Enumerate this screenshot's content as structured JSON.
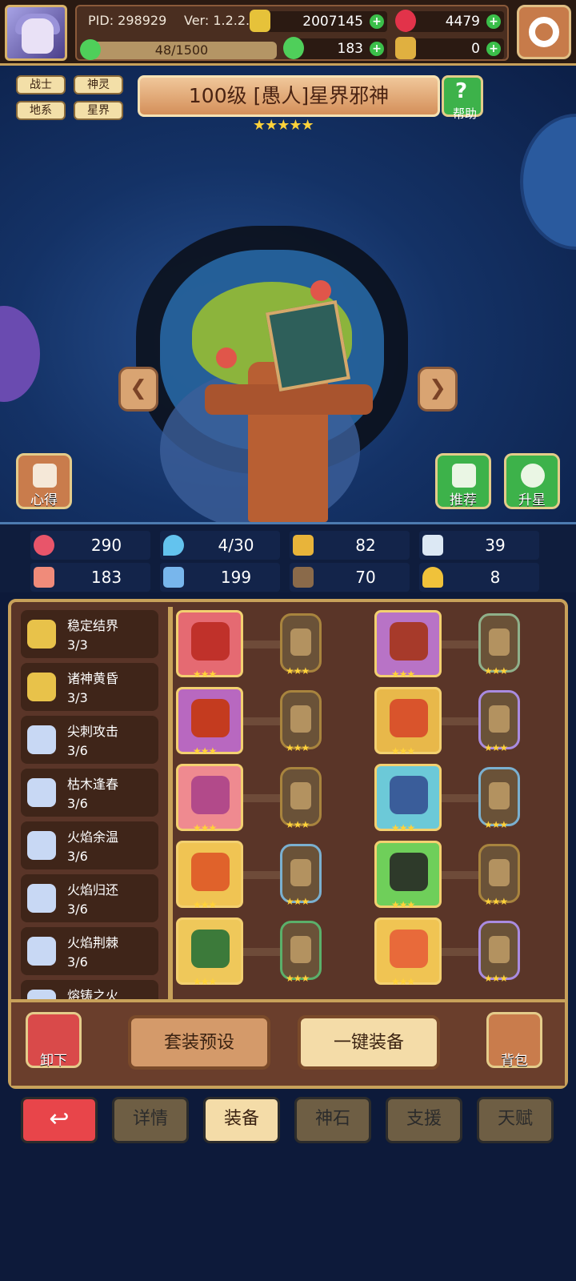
{
  "player": {
    "pid": "PID: 298929",
    "version": "Ver: 1.2.2.1",
    "gold": "2007145",
    "gems": "4479",
    "exp": "48/1500",
    "clover": "183",
    "keys": "0"
  },
  "hero": {
    "tags": [
      "战士",
      "神灵",
      "地系",
      "星界"
    ],
    "title": "100级 [愚人]星界邪神",
    "stars": "★★★★★",
    "help_label": "帮助",
    "prev_arrow": "❮",
    "next_arrow": "❯",
    "left_button": "心得",
    "recommend_button": "推荐",
    "upgrade_button": "升星"
  },
  "stats": [
    {
      "icon": "heart-icon",
      "value": "290",
      "color": "#e8556a"
    },
    {
      "icon": "water-drop-icon",
      "value": "4/30",
      "color": "#63c3ee"
    },
    {
      "icon": "shield-icon",
      "value": "82",
      "color": "#e8b43a"
    },
    {
      "icon": "wing-icon",
      "value": "39",
      "color": "#dce8f4"
    },
    {
      "icon": "fist-icon",
      "value": "183",
      "color": "#f08b7a"
    },
    {
      "icon": "book-icon",
      "value": "199",
      "color": "#78b6ec"
    },
    {
      "icon": "boot-icon",
      "value": "70",
      "color": "#8a6a4a"
    },
    {
      "icon": "horseshoe-icon",
      "value": "8",
      "color": "#f0c23a"
    }
  ],
  "sets": [
    {
      "name": "稳定结界",
      "count": "3/3",
      "color": "#e8c24a"
    },
    {
      "name": "诸神黄昏",
      "count": "3/3",
      "color": "#e8c24a"
    },
    {
      "name": "尖刺攻击",
      "count": "3/6",
      "color": "#c8d8f4"
    },
    {
      "name": "枯木逢春",
      "count": "3/6",
      "color": "#c8d8f4"
    },
    {
      "name": "火焰余温",
      "count": "3/6",
      "color": "#c8d8f4"
    },
    {
      "name": "火焰归还",
      "count": "3/6",
      "color": "#c8d8f4"
    },
    {
      "name": "火焰荆棘",
      "count": "3/6",
      "color": "#c8d8f4"
    },
    {
      "name": "熔铸之火",
      "count": "",
      "color": "#c8d8f4"
    }
  ],
  "equipment": [
    {
      "bg": "#e56a72",
      "art": "#c0312a",
      "stars": "★★★",
      "slot_border": "#a8843e"
    },
    {
      "bg": "#b873c6",
      "art": "#a73a2a",
      "stars": "★★★",
      "slot_border": "#8fb08a"
    },
    {
      "bg": "#b868c0",
      "art": "#c43b1f",
      "stars": "★★★",
      "slot_border": "#a8843e"
    },
    {
      "bg": "#e8b84a",
      "art": "#d9542c",
      "stars": "★★★",
      "slot_border": "#a98be0"
    },
    {
      "bg": "#ef8a90",
      "art": "#b24a8a",
      "stars": "★★★",
      "slot_border": "#a8843e"
    },
    {
      "bg": "#6cc9d8",
      "art": "#3a5d9a",
      "stars": "★★★",
      "slot_border": "#7ab0d0"
    },
    {
      "bg": "#f0c453",
      "art": "#e0622b",
      "stars": "★★★",
      "slot_border": "#7ab0d0"
    },
    {
      "bg": "#6fcf5a",
      "art": "#2e3a2a",
      "stars": "★★★",
      "slot_border": "#a8843e"
    },
    {
      "bg": "#efc85a",
      "art": "#3c7a3a",
      "stars": "★★★",
      "slot_border": "#5ab06a"
    },
    {
      "bg": "#f0c453",
      "art": "#e86a3a",
      "stars": "★★★",
      "slot_border": "#a98be0"
    }
  ],
  "slot_stars": "★★★",
  "actions": {
    "unequip": "卸下",
    "set_preset": "套装预设",
    "equip_all": "一键装备",
    "backpack": "背包"
  },
  "nav": {
    "back": "↩",
    "tabs": [
      "详情",
      "装备",
      "神石",
      "支援",
      "天赋"
    ],
    "active": "装备"
  }
}
